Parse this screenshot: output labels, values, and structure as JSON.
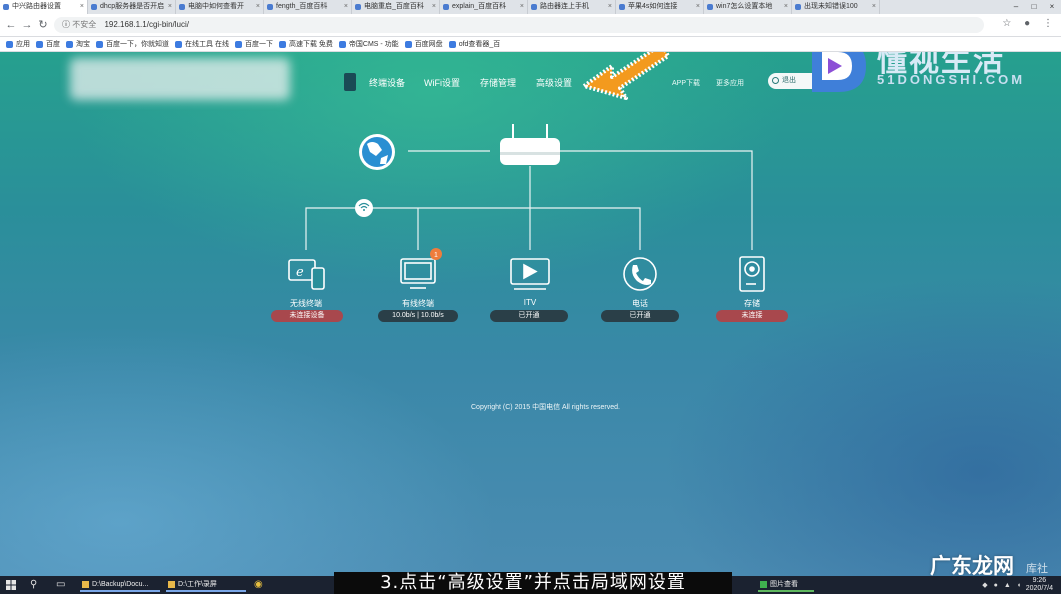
{
  "browser": {
    "tabs": [
      {
        "label": "中兴路由器设置"
      },
      {
        "label": "dhcp服务器是否开启"
      },
      {
        "label": "电脑中如何查看开"
      },
      {
        "label": "fength_百度百科"
      },
      {
        "label": "电脑重启_百度百科"
      },
      {
        "label": "explain_百度百科"
      },
      {
        "label": "路由器连上手机"
      },
      {
        "label": "苹果4s如何连接"
      },
      {
        "label": "win7怎么设置本地"
      },
      {
        "label": "出现未知错误100"
      }
    ],
    "url_insecure": "不安全",
    "url": "192.168.1.1/cgi-bin/luci/",
    "bookmarks": [
      "应用",
      "百度",
      "淘宝",
      "百度一下，你就知道",
      "在线工具 在线",
      "百度一下",
      "高速下载 免费",
      "帝国CMS - 功能",
      "百度网盘",
      "ofd查看器_百"
    ]
  },
  "router": {
    "menu": {
      "devices": "终端设备",
      "wifi": "WiFi设置",
      "storage": "存储管理",
      "advanced": "高级设置",
      "app": "APP下载",
      "more": "更多应用",
      "logout": "退出"
    },
    "devices": [
      {
        "label": "无线终端",
        "status": "未连接设备",
        "status_color": "#a8484d"
      },
      {
        "label": "有线终端",
        "status": "10.0b/s | 10.0b/s",
        "status_color": "#2a3f48",
        "badge": "1"
      },
      {
        "label": "ITV",
        "status": "已开通",
        "status_color": "#2a3f48"
      },
      {
        "label": "电话",
        "status": "已开通",
        "status_color": "#2a3f48"
      },
      {
        "label": "存储",
        "status": "未连接",
        "status_color": "#a8484d"
      }
    ],
    "copyright": "Copyright (C) 2015 中国电信 All rights reserved."
  },
  "watermark": {
    "title": "懂视生活",
    "subtitle": "51DONGSHI.COM",
    "corner": "广东龙网",
    "corner_sub": "库社"
  },
  "taskbar": {
    "apps": [
      "D:\\Backup\\Docu...",
      "D:\\工作\\录屏"
    ],
    "tray_app": "图片查看",
    "clock_time": "9:26",
    "clock_date": "2020/7/4"
  },
  "caption": "3.点击“高级设置”并点击局域网设置",
  "colors": {
    "accent_orange": "#f39a1e",
    "status_red": "#a8484d",
    "status_dark": "#2a3f48"
  }
}
